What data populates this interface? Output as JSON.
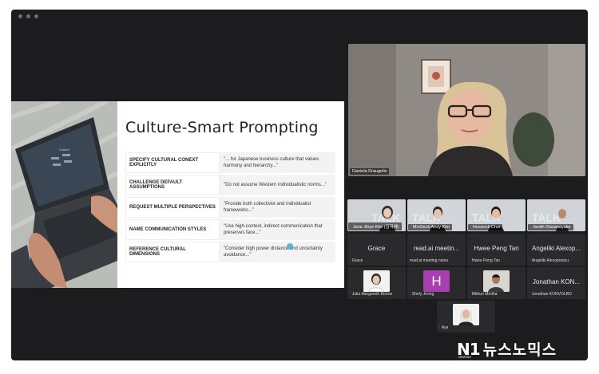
{
  "slide": {
    "title": "Culture-Smart Prompting",
    "laptop_screen_text": "Culture",
    "tips": [
      {
        "label": "SPECIFY CULTURAL CONEXT EXPLICITLY",
        "text": "\"... for Japanese business culture that values harmony and hierarchy...\""
      },
      {
        "label": "CHALLENGE DEFAULT ASSUMPTIONS",
        "text": "\"Do not assume Western individualistic norms...\""
      },
      {
        "label": "REQUEST MULTIPLE PERSPECTIVES",
        "text": "\"Provide both collectivist and individualist frameworks...\""
      },
      {
        "label": "NAME COMMUNICATION STYLES",
        "text": "\"Use high-context, indirect communication that preserves face...\""
      },
      {
        "label": "REFERENCE CULTURAL DIMENSIONS",
        "text": "\"Consider high power distance and uncertainty avoidance...\""
      }
    ]
  },
  "speaker": {
    "name": "Daniela Draugelis"
  },
  "participants": [
    {
      "label": "Jane Jihye Kim (김지혜)",
      "big": ""
    },
    {
      "label": "MinSeok Andy Kim",
      "big": ""
    },
    {
      "label": "Hoseock Choi",
      "big": ""
    },
    {
      "label": "Janith Dissanayake",
      "big": ""
    },
    {
      "label": "Grace",
      "big": "Grace"
    },
    {
      "label": "read.ai meeting notes",
      "big": "read.ai meetin..."
    },
    {
      "label": "Hwee Peng Tan",
      "big": "Hwee Peng Tan"
    },
    {
      "label": "Angeliki Alexopoulou",
      "big": "Angeliki Alexop..."
    },
    {
      "label": "Julia Margareth Borres",
      "big": ""
    },
    {
      "label": "Shirly Jeong",
      "big": "",
      "initial": "H"
    },
    {
      "label": "Mithun Mridha",
      "big": ""
    },
    {
      "label": "Jonathan KONVOLBO",
      "big": "Jonathan KON..."
    },
    {
      "label": "Aya",
      "big": ""
    }
  ],
  "watermark": {
    "mark": "N1",
    "sub": "NEWSIS",
    "text": "뉴스노믹스"
  },
  "colors": {
    "window_bg": "#1c1c1e",
    "muted_mic": "#e04b4b",
    "avatar_h": "#a83fae"
  }
}
